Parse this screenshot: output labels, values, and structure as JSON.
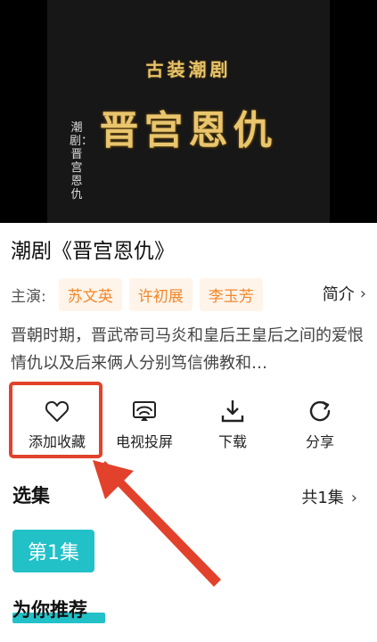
{
  "video": {
    "subtitle": "古装潮剧",
    "title": "晋宫恩仇",
    "caption": "潮剧：晋宫恩仇"
  },
  "drama_title": "潮剧《晋宫恩仇》",
  "cast": {
    "label": "主演:",
    "actors": [
      "苏文英",
      "许初展",
      "李玉芳"
    ],
    "intro_label": "简介",
    "intro_icon": "chevron-right-icon"
  },
  "synopsis": "晋朝时期，晋武帝司马炎和皇后王皇后之间的爱恨情仇以及后来俩人分别笃信佛教和…",
  "actions": [
    {
      "label": "添加收藏",
      "icon": "heart-icon"
    },
    {
      "label": "电视投屏",
      "icon": "tv-cast-icon"
    },
    {
      "label": "下载",
      "icon": "download-icon"
    },
    {
      "label": "分享",
      "icon": "share-icon"
    }
  ],
  "episodes": {
    "title": "选集",
    "count_label": "共1集",
    "items": [
      "第1集"
    ]
  },
  "recommend": {
    "title": "为你推荐"
  },
  "colors": {
    "accent": "#22c1c8",
    "tag_bg": "#fff4e9",
    "tag_text": "#f0872c",
    "highlight": "#e2412b"
  }
}
